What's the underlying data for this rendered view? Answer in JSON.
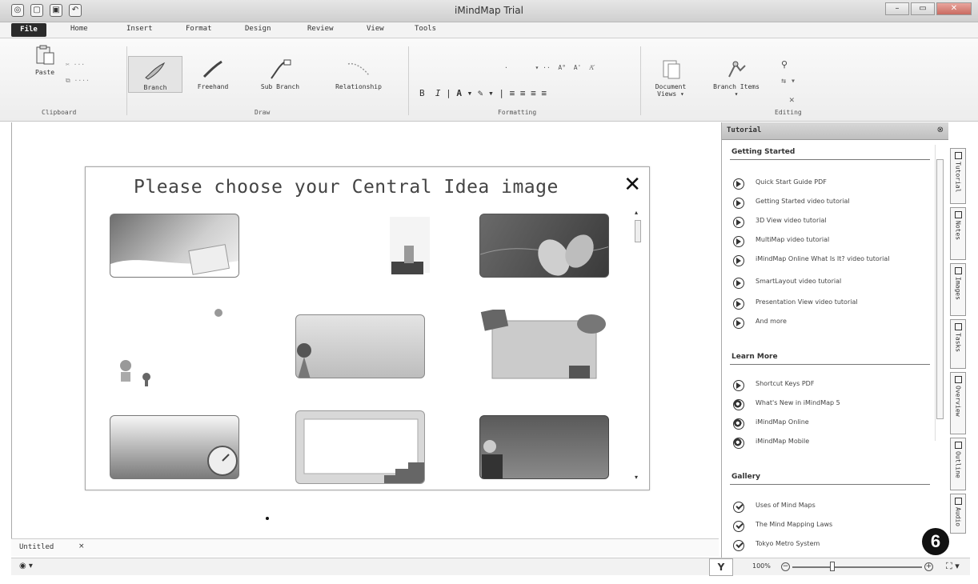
{
  "window": {
    "title": "iMindMap Trial"
  },
  "menu": {
    "file": "File",
    "tabs": [
      "Home",
      "Insert",
      "Format",
      "Design",
      "Review",
      "View",
      "Tools"
    ]
  },
  "ribbon": {
    "paste": "Paste",
    "clipboard_label": "Clipboard",
    "branch": "Branch",
    "freehand": "Freehand",
    "sub_branch": "Sub Branch",
    "relationship": "Relationship",
    "draw_label": "Draw",
    "formatting_label": "Formatting",
    "document_views": "Document Views ▾",
    "branch_items": "Branch Items ▾",
    "editing_label": "Editing"
  },
  "dialog": {
    "title": "Please choose your Central Idea image",
    "close": "✕"
  },
  "tutorial": {
    "header": "Tutorial",
    "getting_started": {
      "title": "Getting Started",
      "items": [
        "Quick Start Guide PDF",
        "Getting Started video tutorial",
        "3D View video tutorial",
        "MultiMap video tutorial",
        "iMindMap Online What Is It? video tutorial",
        "SmartLayout video tutorial",
        "Presentation View video tutorial",
        "And more"
      ]
    },
    "learn_more": {
      "title": "Learn More",
      "items": [
        "Shortcut Keys PDF",
        "What's New in iMindMap 5",
        "iMindMap Online",
        "iMindMap Mobile"
      ]
    },
    "gallery": {
      "title": "Gallery",
      "items": [
        "Uses of Mind Maps",
        "The Mind Mapping Laws",
        "Tokyo Metro System"
      ]
    }
  },
  "side_tabs": [
    "Tutorial",
    "Notes",
    "Images",
    "Tasks",
    "Overview",
    "Outline",
    "Audio"
  ],
  "doc_tab": {
    "name": "Untitled",
    "close": "×"
  },
  "status": {
    "zoom": "100%",
    "zoom_level": 0.3
  },
  "step_badge": "6"
}
